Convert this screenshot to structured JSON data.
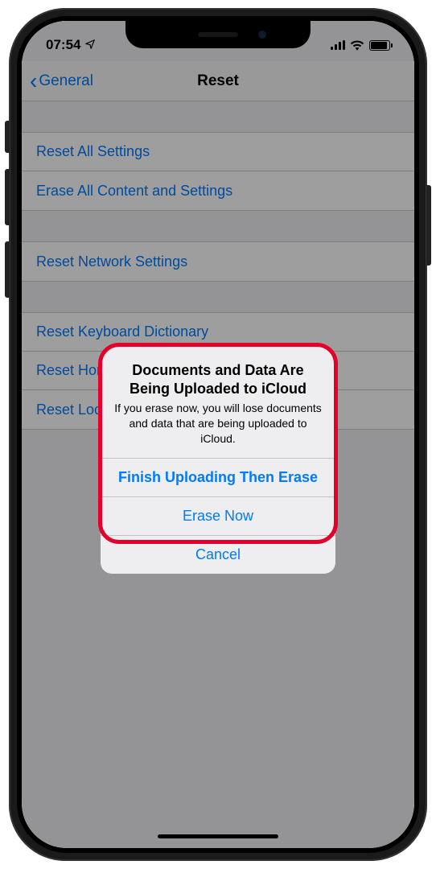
{
  "status": {
    "time": "07:54"
  },
  "nav": {
    "back": "General",
    "title": "Reset"
  },
  "groups": [
    {
      "items": [
        "Reset All Settings",
        "Erase All Content and Settings"
      ]
    },
    {
      "items": [
        "Reset Network Settings"
      ]
    },
    {
      "items": [
        "Reset Keyboard Dictionary",
        "Reset Home Screen Layout",
        "Reset Location & Privacy"
      ]
    }
  ],
  "alert": {
    "title": "Documents and Data Are Being Uploaded to iCloud",
    "message": "If you erase now, you will lose documents and data that are being uploaded to iCloud.",
    "buttons": {
      "primary": "Finish Uploading Then Erase",
      "secondary": "Erase Now",
      "cancel": "Cancel"
    }
  }
}
